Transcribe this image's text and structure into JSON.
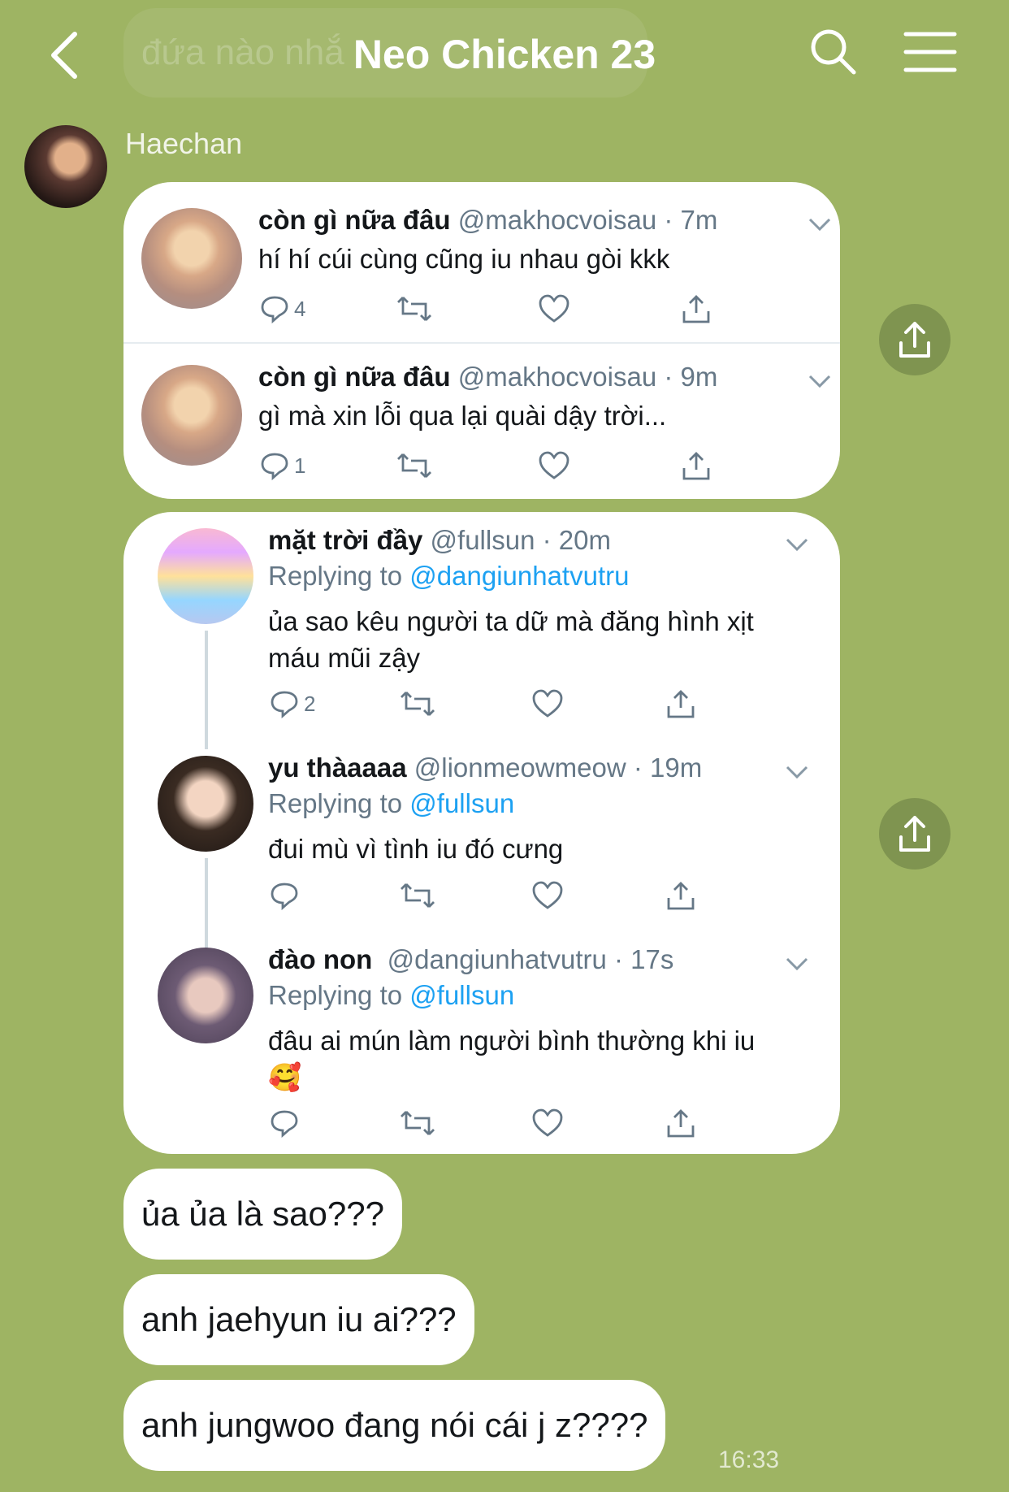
{
  "header": {
    "title": "Neo Chicken 23",
    "faded_message": "đứa nào nhắ"
  },
  "sender": {
    "name": "Haechan"
  },
  "card1": {
    "tweets": [
      {
        "name": "còn gì nữa đâu",
        "handle": "@makhocvoisau",
        "time": "7m",
        "text": "hí hí cúi cùng cũng iu nhau gòi kkk",
        "replies": "4"
      },
      {
        "name": "còn gì nữa đâu",
        "handle": "@makhocvoisau",
        "time": "9m",
        "text": "gì mà xin lỗi qua lại quài dậy trời...",
        "replies": "1"
      }
    ]
  },
  "card2": {
    "tweets": [
      {
        "name": "mặt trời đầy",
        "handle": "@fullsun",
        "time": "20m",
        "replying_label": "Replying to",
        "replying_to": "@dangiunhatvutru",
        "text": "ủa sao kêu người ta dữ mà đăng hình xịt máu mũi zậy",
        "replies": "2"
      },
      {
        "name": "yu thàaaaa",
        "handle": "@lionmeowmeow",
        "time": "19m",
        "replying_label": "Replying to",
        "replying_to": "@fullsun",
        "text": "đui mù vì tình iu đó cưng",
        "replies": ""
      },
      {
        "name": "đào non",
        "handle": "@dangiunhatvutru",
        "time": "17s",
        "replying_label": "Replying to",
        "replying_to": "@fullsun",
        "text": "đâu ai mún làm người bình thường khi iu 🥰",
        "replies": ""
      }
    ]
  },
  "messages": [
    {
      "text": "ủa ủa là sao???"
    },
    {
      "text": "anh jaehyun iu ai???"
    },
    {
      "text": "anh jungwoo đang nói cái j z????"
    }
  ],
  "timestamp": "16:33",
  "icons": {
    "back": "chevron-left-icon",
    "search": "search-icon",
    "menu": "hamburger-menu-icon",
    "reply": "reply-icon",
    "retweet": "retweet-icon",
    "like": "heart-icon",
    "share": "share-icon",
    "caret": "chevron-down-icon"
  },
  "colors": {
    "background": "#9eb463",
    "link": "#1da1f2",
    "muted": "#657786"
  }
}
